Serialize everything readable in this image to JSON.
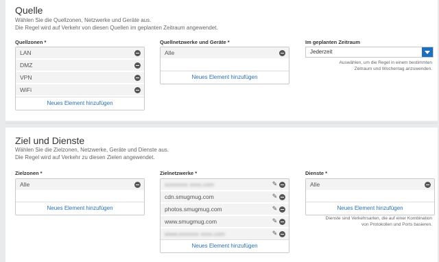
{
  "source": {
    "title": "Quelle",
    "desc1": "Wählen Sie die Quellzonen, Netzwerke und Geräte aus.",
    "desc2": "Die Regel wird auf Verkehr von diesen Quellen im geplanten Zeitraum angewendet.",
    "zones_label": "Quellzonen *",
    "zones": [
      "LAN",
      "DMZ",
      "VPN",
      "WiFi"
    ],
    "zones_add": "Neues Element hinzufügen",
    "networks_label": "Quellnetzwerke und Geräte *",
    "networks": [
      "Alle"
    ],
    "networks_add": "Neues Element hinzufügen",
    "schedule_label": "Im geplanten Zeitraum",
    "schedule_value": "Jederzeit",
    "schedule_hint1": "Auswählen, um die Regel in einem bestimmten",
    "schedule_hint2": "Zeitraum und Wochentag anzuwenden."
  },
  "destination": {
    "title": "Ziel und Dienste",
    "desc1": "Wählen Sie die Zielzonen, Netzwerke, Geräte und Dienste aus.",
    "desc2": "Die Regel wird auf Verkehr zu diesen Zielen angewendet.",
    "zones_label": "Zielzonen *",
    "zones": [
      "Alle"
    ],
    "zones_add": "Neues Element hinzufügen",
    "networks_label": "Zielnetzwerke *",
    "networks": [
      "xxxxxxxx xxxx.com",
      "cdn.smugmug.com",
      "photos.smugmug.com",
      "www.smugmug.com",
      "www.xxxxxxx xxxx.com"
    ],
    "networks_add": "Neues Element hinzufügen",
    "services_label": "Dienste *",
    "services": [
      "Alle"
    ],
    "services_add": "Neues Element hinzufügen",
    "services_hint1": "Dienste sind Verkehrsarten, die auf einer Kombination",
    "services_hint2": "von Protokollen und Ports basieren."
  },
  "icons": {
    "remove": "minus-circle-icon",
    "edit": "pencil-icon",
    "dropdown": "chevron-down-icon"
  },
  "colors": {
    "accent": "#1f6fbf",
    "link": "#2a6fb0"
  }
}
